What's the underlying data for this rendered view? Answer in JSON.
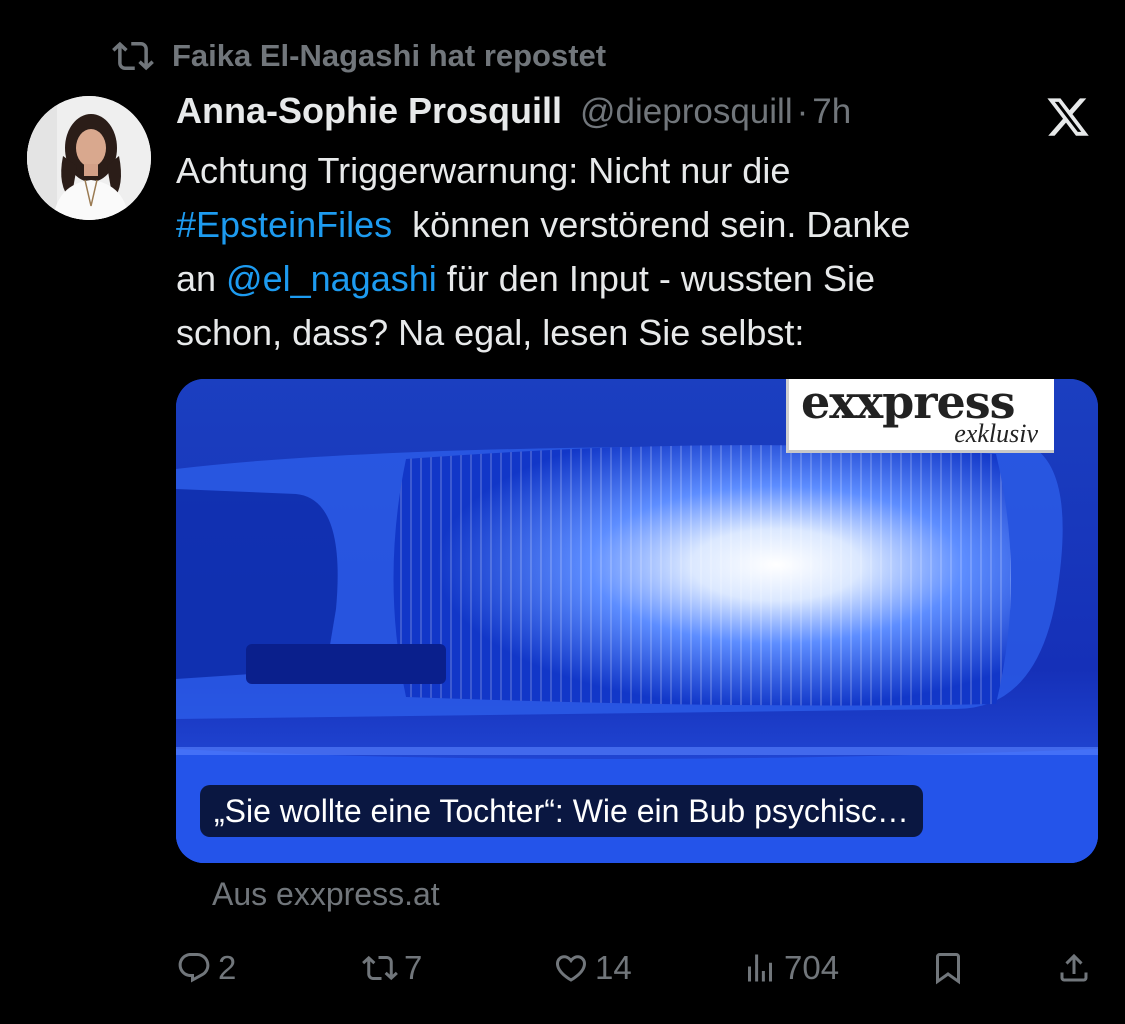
{
  "repost": {
    "icon": "repost-icon",
    "text": "Faika El-Nagashi hat repostet"
  },
  "author": {
    "name": "Anna-Sophie Prosquill",
    "handle": "@dieprosquill",
    "separator": "·",
    "time": "7h"
  },
  "platform_logo": "x-logo-icon",
  "tweet": {
    "line1": "Achtung Triggerwarnung: Nicht nur die",
    "hashtag": "#EpsteinFiles",
    "line2_rest": "  können verstörend sein. Danke",
    "line3_start": "an ",
    "mention": "@el_nagashi",
    "line3_rest": " für den Input - wussten Sie",
    "line4": "schon, dass? Na egal, lesen Sie selbst:"
  },
  "card": {
    "brand_word": "exxpress",
    "brand_sub": "exklusiv",
    "caption": "„Sie wollte eine Tochter“: Wie ein Bub psychisc…",
    "source": "Aus exxpress.at"
  },
  "actions": {
    "replies": "2",
    "reposts": "7",
    "likes": "14",
    "views": "704"
  },
  "colors": {
    "background": "#000000",
    "text": "#e7e9ea",
    "secondary": "#71767b",
    "link": "#1d9bf0"
  }
}
